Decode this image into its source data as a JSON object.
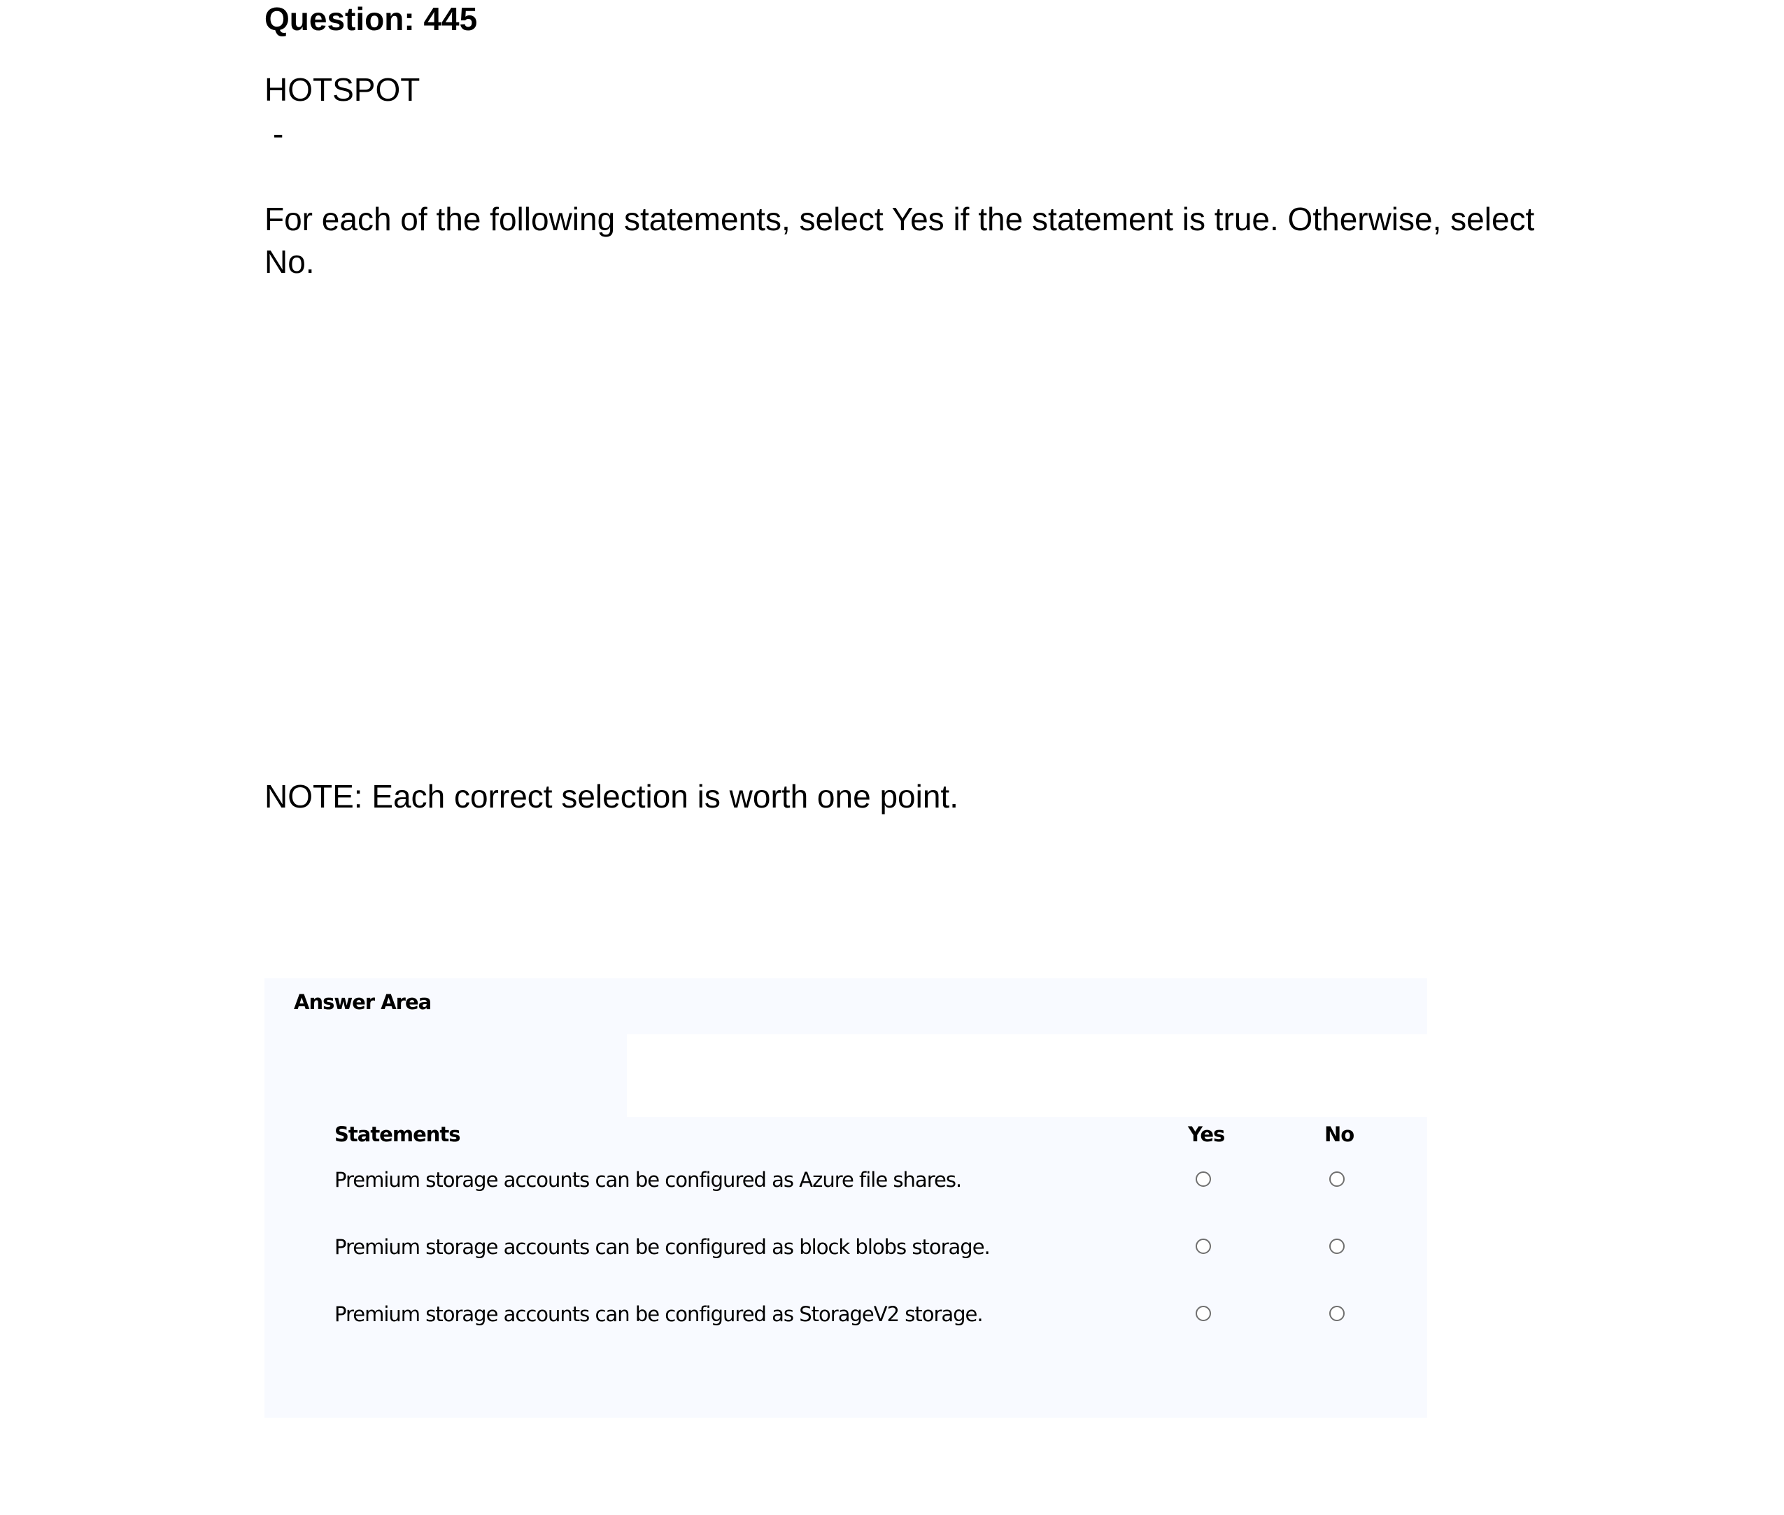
{
  "question": {
    "title": "Question: 445",
    "type": "HOTSPOT",
    "dash": "-",
    "instructions": "For each of the following statements, select Yes if the statement is true. Otherwise, select No.",
    "note": "NOTE: Each correct selection is worth one point."
  },
  "answer_area": {
    "title": "Answer Area",
    "headers": {
      "statements": "Statements",
      "yes": "Yes",
      "no": "No"
    },
    "statements": [
      {
        "text": "Premium storage accounts can be configured as Azure file shares.",
        "yes_selected": false,
        "no_selected": false
      },
      {
        "text": "Premium storage accounts can be configured as block blobs storage.",
        "yes_selected": false,
        "no_selected": false
      },
      {
        "text": "Premium storage accounts can be configured as StorageV2 storage.",
        "yes_selected": false,
        "no_selected": false
      }
    ]
  }
}
